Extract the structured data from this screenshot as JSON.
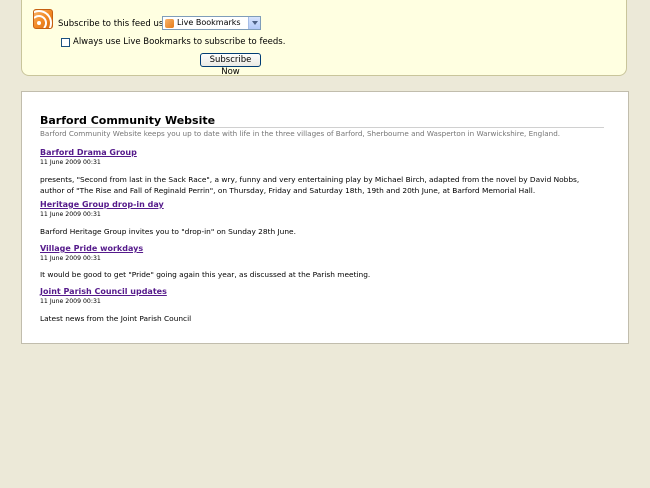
{
  "subscribe": {
    "label": "Subscribe to this feed using",
    "reader_selected": "Live Bookmarks",
    "always_use_label": "Always use Live Bookmarks to subscribe to feeds.",
    "always_use_checked": false,
    "button_label": "Subscribe Now"
  },
  "feed": {
    "title": "Barford Community Website",
    "description": "Barford Community Website keeps you up to date with life in the three villages of Barford, Sherbourne and Wasperton in Warwickshire, England.",
    "entries": [
      {
        "title": "Barford Drama Group",
        "date": "11 June 2009 00:31",
        "body": "presents, \"Second from last in the Sack Race\", a wry, funny and very entertaining play by Michael Birch, adapted from the novel by David Nobbs, author of \"The Rise and Fall of Reginald Perrin\", on Thursday, Friday and Saturday 18th, 19th and 20th June, at Barford Memorial Hall."
      },
      {
        "title": "Heritage Group drop-in day",
        "date": "11 June 2009 00:31",
        "body": "Barford Heritage Group invites you to \"drop-in\" on Sunday 28th June."
      },
      {
        "title": "Village Pride workdays",
        "date": "11 June 2009 00:31",
        "body": "It would be good to get \"Pride\" going again this year, as discussed at the Parish meeting."
      },
      {
        "title": "Joint Parish Council updates",
        "date": "11 June 2009 00:31",
        "body": "Latest news from the Joint Parish Council"
      }
    ]
  }
}
